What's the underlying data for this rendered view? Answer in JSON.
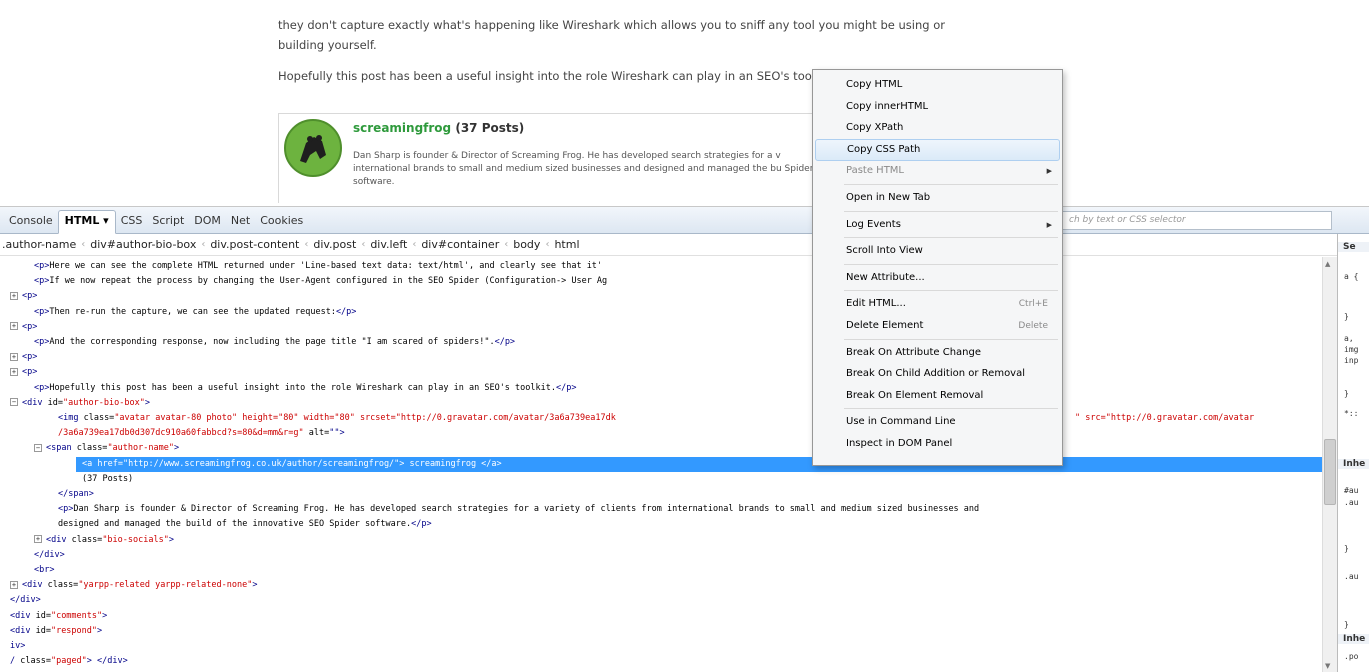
{
  "page": {
    "para1": "they don't capture exactly what's happening like Wireshark which allows you to sniff any tool you might be using or building yourself.",
    "para2": "Hopefully this post has been a useful insight into the role Wireshark can play in an SEO's tool",
    "author": {
      "name": "screamingfrog",
      "count": "(37 Posts)",
      "bio": "Dan Sharp is founder & Director of Screaming Frog. He has developed search strategies for a v international brands to small and medium sized businesses and designed and managed the bu Spider software."
    }
  },
  "firebug": {
    "tabs": [
      "Console",
      "HTML ▾",
      "CSS",
      "Script",
      "DOM",
      "Net",
      "Cookies"
    ],
    "active_tab": "HTML ▾",
    "search_placeholder": "ch by text or CSS selector",
    "breadcrumbs": [
      ".author-name",
      "div#author-bio-box",
      "div.post-content",
      "div.post",
      "div.left",
      "div#container",
      "body",
      "html"
    ],
    "html_lines": [
      {
        "indent": 1,
        "tw": "",
        "tag": "<p>",
        "text": "Here we can see the complete HTML returned under 'Line-based text data: text/html', and clearly see that it'",
        "tag2": ""
      },
      {
        "indent": 1,
        "tw": "",
        "tag": "<p>",
        "text": "If we now repeat the process by changing the User-Agent configured in the SEO Spider (Configuration-> User Ag",
        "tag2": ""
      },
      {
        "indent": 0,
        "tw": "⊞",
        "tag": "<p>",
        "text": "",
        "tag2": ""
      },
      {
        "indent": 1,
        "tw": "",
        "tag": "<p>",
        "text": "Then re-run the capture, we can see the updated request:",
        "tag2": "</p>"
      },
      {
        "indent": 0,
        "tw": "⊞",
        "tag": "<p>",
        "text": "",
        "tag2": ""
      },
      {
        "indent": 1,
        "tw": "",
        "tag": "<p>",
        "text": "And the corresponding response, now including the page title \"I am scared of spiders!\".",
        "tag2": "</p>"
      },
      {
        "indent": 0,
        "tw": "⊞",
        "tag": "<p>",
        "text": "",
        "tag2": ""
      },
      {
        "indent": 0,
        "tw": "⊞",
        "tag": "<p>",
        "text": "",
        "tag2": ""
      },
      {
        "indent": 1,
        "tw": "",
        "tag": "<p>",
        "text": "Hopefully this post has been a useful insight into the role Wireshark can play in an SEO's toolkit.",
        "tag2": "</p>"
      },
      {
        "indent": 0,
        "tw": "⊟",
        "tag": "<div ",
        "attr": "id=",
        "val": "\"author-bio-box\"",
        "tag2": ">"
      },
      {
        "indent": 2,
        "tw": "",
        "tag": "<img ",
        "attr": "class=",
        "val": "\"avatar avatar-80 photo\" height=\"80\" width=\"80\" srcset=\"http://0.gravatar.com/avatar/3a6a739ea17dk",
        "tag2": "",
        "tail": "\" src=\"http://0.gravatar.com/avatar"
      },
      {
        "indent": 2,
        "tw": "",
        "tag": "",
        "val": "/3a6a739ea17db0d307dc910a60fabbcd?s=80&d=mm&r=g\"",
        "attr": " alt=",
        "tag2": "\"\">"
      },
      {
        "indent": 1,
        "tw": "⊟",
        "tag": "<span ",
        "attr": "class=",
        "val": "\"author-name\"",
        "tag2": ">"
      },
      {
        "indent": 3,
        "tw": "",
        "tag": "<a ",
        "attr": "href=",
        "val": "\"http://www.screamingfrog.co.uk/author/screamingfrog/\"",
        "tag2": "> screamingfrog </a>",
        "selected": true
      },
      {
        "indent": 3,
        "tw": "",
        "tag": "",
        "text": "(37 Posts)",
        "tag2": ""
      },
      {
        "indent": 2,
        "tw": "",
        "tag": "</span>",
        "text": "",
        "tag2": ""
      },
      {
        "indent": 2,
        "tw": "",
        "tag": "<p>",
        "text": "Dan Sharp is founder & Director of Screaming Frog. He has developed search strategies for a variety of clients from international brands to small and medium sized businesses and",
        "tag2": ""
      },
      {
        "indent": 2,
        "tw": "",
        "tag": "",
        "text": "designed and managed the build of the innovative SEO Spider software.",
        "tag2": "</p>"
      },
      {
        "indent": 1,
        "tw": "⊞",
        "tag": "<div ",
        "attr": "class=",
        "val": "\"bio-socials\"",
        "tag2": ">"
      },
      {
        "indent": 1,
        "tw": "",
        "tag": "</div>",
        "text": "",
        "tag2": ""
      },
      {
        "indent": 1,
        "tw": "",
        "tag": "<br>",
        "text": "",
        "tag2": ""
      },
      {
        "indent": 0,
        "tw": "⊞",
        "tag": "<div ",
        "attr": "class=",
        "val": "\"yarpp-related yarpp-related-none\"",
        "tag2": ">"
      },
      {
        "indent": 0,
        "tw": "",
        "tag": "</div>",
        "text": "",
        "tag2": ""
      },
      {
        "indent": 0,
        "tw": "",
        "tag": "<div ",
        "attr": "id=",
        "val": "\"comments\"",
        "tag2": ">"
      },
      {
        "indent": 0,
        "tw": "",
        "tag": "<div ",
        "attr": "id=",
        "val": "\"respond\"",
        "tag2": ">"
      },
      {
        "indent": 0,
        "tw": "",
        "tag": "iv>",
        "text": "",
        "tag2": ""
      },
      {
        "indent": 0,
        "tw": "",
        "tag": "/ ",
        "attr": "class=",
        "val": "\"paged\"",
        "tag2": "> </div>"
      }
    ],
    "side_lines": [
      "Se",
      "a {",
      "}",
      "a,",
      "img",
      "inp",
      "}",
      "*::",
      "Inhe",
      "#au",
      ".au",
      "}",
      ".au",
      "}",
      "Inhe",
      ".po"
    ]
  },
  "context_menu": {
    "items": [
      {
        "label": "Copy HTML",
        "shortcut": "",
        "sub": false,
        "disabled": false,
        "hover": false
      },
      {
        "label": "Copy innerHTML",
        "shortcut": "",
        "sub": false,
        "disabled": false,
        "hover": false
      },
      {
        "label": "Copy XPath",
        "shortcut": "",
        "sub": false,
        "disabled": false,
        "hover": false
      },
      {
        "label": "Copy CSS Path",
        "shortcut": "",
        "sub": false,
        "disabled": false,
        "hover": true
      },
      {
        "label": "Paste HTML",
        "shortcut": "",
        "sub": true,
        "disabled": true,
        "hover": false
      },
      {
        "sep": true
      },
      {
        "label": "Open in New Tab",
        "shortcut": "",
        "sub": false,
        "disabled": false,
        "hover": false
      },
      {
        "sep": true
      },
      {
        "label": "Log Events",
        "shortcut": "",
        "sub": true,
        "disabled": false,
        "hover": false
      },
      {
        "sep": true
      },
      {
        "label": "Scroll Into View",
        "shortcut": "",
        "sub": false,
        "disabled": false,
        "hover": false
      },
      {
        "sep": true
      },
      {
        "label": "New Attribute...",
        "shortcut": "",
        "sub": false,
        "disabled": false,
        "hover": false
      },
      {
        "sep": true
      },
      {
        "label": "Edit HTML...",
        "shortcut": "Ctrl+E",
        "sub": false,
        "disabled": false,
        "hover": false
      },
      {
        "label": "Delete Element",
        "shortcut": "Delete",
        "sub": false,
        "disabled": false,
        "hover": false
      },
      {
        "sep": true
      },
      {
        "label": "Break On Attribute Change",
        "shortcut": "",
        "sub": false,
        "disabled": false,
        "hover": false
      },
      {
        "label": "Break On Child Addition or Removal",
        "shortcut": "",
        "sub": false,
        "disabled": false,
        "hover": false
      },
      {
        "label": "Break On Element Removal",
        "shortcut": "",
        "sub": false,
        "disabled": false,
        "hover": false
      },
      {
        "sep": true
      },
      {
        "label": "Use in Command Line",
        "shortcut": "",
        "sub": false,
        "disabled": false,
        "hover": false
      },
      {
        "label": "Inspect in DOM Panel",
        "shortcut": "",
        "sub": false,
        "disabled": false,
        "hover": false
      }
    ]
  },
  "colors": {
    "selection": "#3399ff",
    "tag": "#000088",
    "value": "#cc0000",
    "author_link": "#2f9a3c"
  },
  "icons": {
    "avatar": "frog-logo-icon",
    "expand": "expand-toggle-icon",
    "collapse": "collapse-toggle-icon",
    "submenu": "submenu-arrow-icon"
  }
}
